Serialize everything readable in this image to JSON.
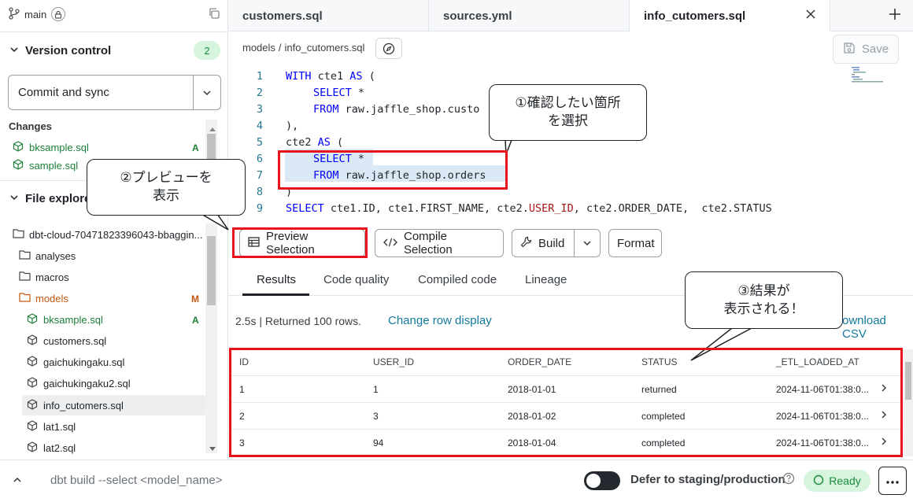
{
  "sidebar": {
    "branch": "main",
    "version_control": {
      "title": "Version control",
      "count": "2"
    },
    "commit_button": "Commit and sync",
    "changes": {
      "title": "Changes",
      "items": [
        {
          "name": "bksample.sql",
          "status": "A"
        },
        {
          "name": "sample.sql",
          "status": ""
        }
      ]
    },
    "explorer": {
      "title": "File explore",
      "root": "dbt-cloud-70471823396043-bbaggin...",
      "items": [
        {
          "name": "analyses",
          "type": "folder",
          "status": ""
        },
        {
          "name": "macros",
          "type": "folder",
          "status": ""
        },
        {
          "name": "models",
          "type": "folder",
          "status": "M"
        },
        {
          "name": "bksample.sql",
          "type": "file",
          "status": "A"
        },
        {
          "name": "customers.sql",
          "type": "file",
          "status": ""
        },
        {
          "name": "gaichukingaku.sql",
          "type": "file",
          "status": ""
        },
        {
          "name": "gaichukingaku2.sql",
          "type": "file",
          "status": ""
        },
        {
          "name": "info_cutomers.sql",
          "type": "file",
          "status": ""
        },
        {
          "name": "lat1.sql",
          "type": "file",
          "status": ""
        },
        {
          "name": "lat2.sql",
          "type": "file",
          "status": ""
        }
      ]
    }
  },
  "tabs": [
    "customers.sql",
    "sources.yml",
    "info_cutomers.sql"
  ],
  "active_tab": "info_cutomers.sql",
  "breadcrumb": {
    "folder": "models",
    "sep": "/",
    "file": "info_cutomers.sql"
  },
  "save_label": "Save",
  "code": {
    "line_numbers": [
      "1",
      "2",
      "3",
      "4",
      "5",
      "6",
      "7",
      "8",
      "9"
    ],
    "l1": {
      "kw1": "WITH",
      "t1": " cte1 ",
      "kw2": "AS",
      "t2": " ("
    },
    "l2": {
      "kw1": "SELECT",
      "t1": " *"
    },
    "l3": {
      "kw1": "FROM",
      "t1": " raw.jaffle_shop.custo"
    },
    "l4": {
      "t1": "),"
    },
    "l5": {
      "t1": "cte2 ",
      "kw1": "AS",
      "t2": " ("
    },
    "l6": {
      "kw1": "SELECT",
      "t1": " *"
    },
    "l7": {
      "kw1": "FROM",
      "t1": " raw.jaffle_shop.orders"
    },
    "l8": {
      "t1": ")"
    },
    "l9": {
      "kw1": "SELECT",
      "t1": " cte1.ID, cte1.FIRST_NAME, cte2.",
      "pk": "USER_ID",
      "t2": ", cte2.ORDER_DATE,  cte2.STATUS"
    }
  },
  "toolbar": {
    "preview": "Preview Selection",
    "compile": "Compile Selection",
    "build": "Build",
    "format": "Format"
  },
  "result_tabs": [
    "Results",
    "Code quality",
    "Compiled code",
    "Lineage"
  ],
  "run_info": "2.5s | Returned 100 rows.",
  "change_row_display": "Change row display",
  "download_csv": "ownload CSV",
  "grid": {
    "columns": [
      "ID",
      "USER_ID",
      "ORDER_DATE",
      "STATUS",
      "_ETL_LOADED_AT"
    ],
    "rows": [
      [
        "1",
        "1",
        "2018-01-01",
        "returned",
        "2024-11-06T01:38:0..."
      ],
      [
        "2",
        "3",
        "2018-01-02",
        "completed",
        "2024-11-06T01:38:0..."
      ],
      [
        "3",
        "94",
        "2018-01-04",
        "completed",
        "2024-11-06T01:38:0..."
      ]
    ]
  },
  "bottom": {
    "command_placeholder": "dbt build --select <model_name>",
    "defer_label": "Defer to staging/production",
    "status": "Ready"
  },
  "annotations": {
    "c1_line1": "①確認したい箇所",
    "c1_line2": "を選択",
    "c2_line1": "②プレビューを",
    "c2_line2": "表示",
    "c3_line1": "③結果が",
    "c3_line2": "表示される！"
  },
  "colors": {
    "annotation_red": "#e8141c",
    "added_green": "#1b7f37",
    "modified_orange": "#c2570c",
    "link": "#157a9c"
  }
}
